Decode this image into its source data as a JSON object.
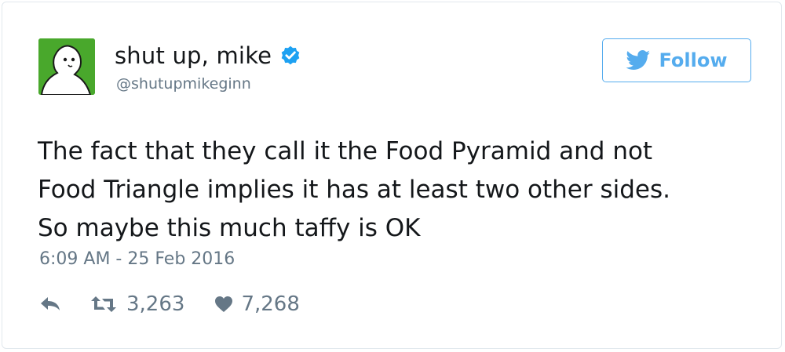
{
  "user": {
    "display_name": "shut up, mike",
    "handle": "@shutupmikeginn",
    "verified": true,
    "avatar_color": "#49a82c"
  },
  "follow_button": {
    "label": "Follow",
    "icon": "twitter-bird-icon",
    "color": "#55acee"
  },
  "tweet": {
    "lines": [
      "The fact that they call it the Food Pyramid and not",
      "Food Triangle implies it has at least two other sides.",
      "So maybe this much taffy is OK"
    ],
    "timestamp": "6:09 AM - 25 Feb 2016"
  },
  "actions": {
    "reply_icon": "reply-icon",
    "retweet_icon": "retweet-icon",
    "retweet_count": "3,263",
    "like_icon": "heart-icon",
    "like_count": "7,268"
  }
}
